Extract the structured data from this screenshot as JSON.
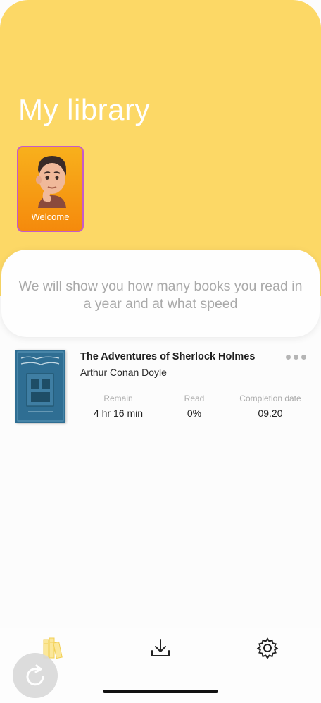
{
  "header": {
    "title": "My library",
    "welcome_card_label": "Welcome",
    "background_color": "#fcd866"
  },
  "stats_card": {
    "message": "We will show you how many books you read in a year and at what speed"
  },
  "book": {
    "title": "The Adventures of Sherlock Holmes",
    "author": "Arthur Conan Doyle",
    "stats": {
      "remain_label": "Remain",
      "remain_value": "4 hr 16 min",
      "read_label": "Read",
      "read_value": "0%",
      "completion_label": "Completion date",
      "completion_value": "09.20"
    }
  },
  "tabbar": {
    "items": [
      {
        "icon": "library-books-icon",
        "active": true
      },
      {
        "icon": "download-icon",
        "active": false
      },
      {
        "icon": "gear-icon",
        "active": false
      }
    ]
  }
}
